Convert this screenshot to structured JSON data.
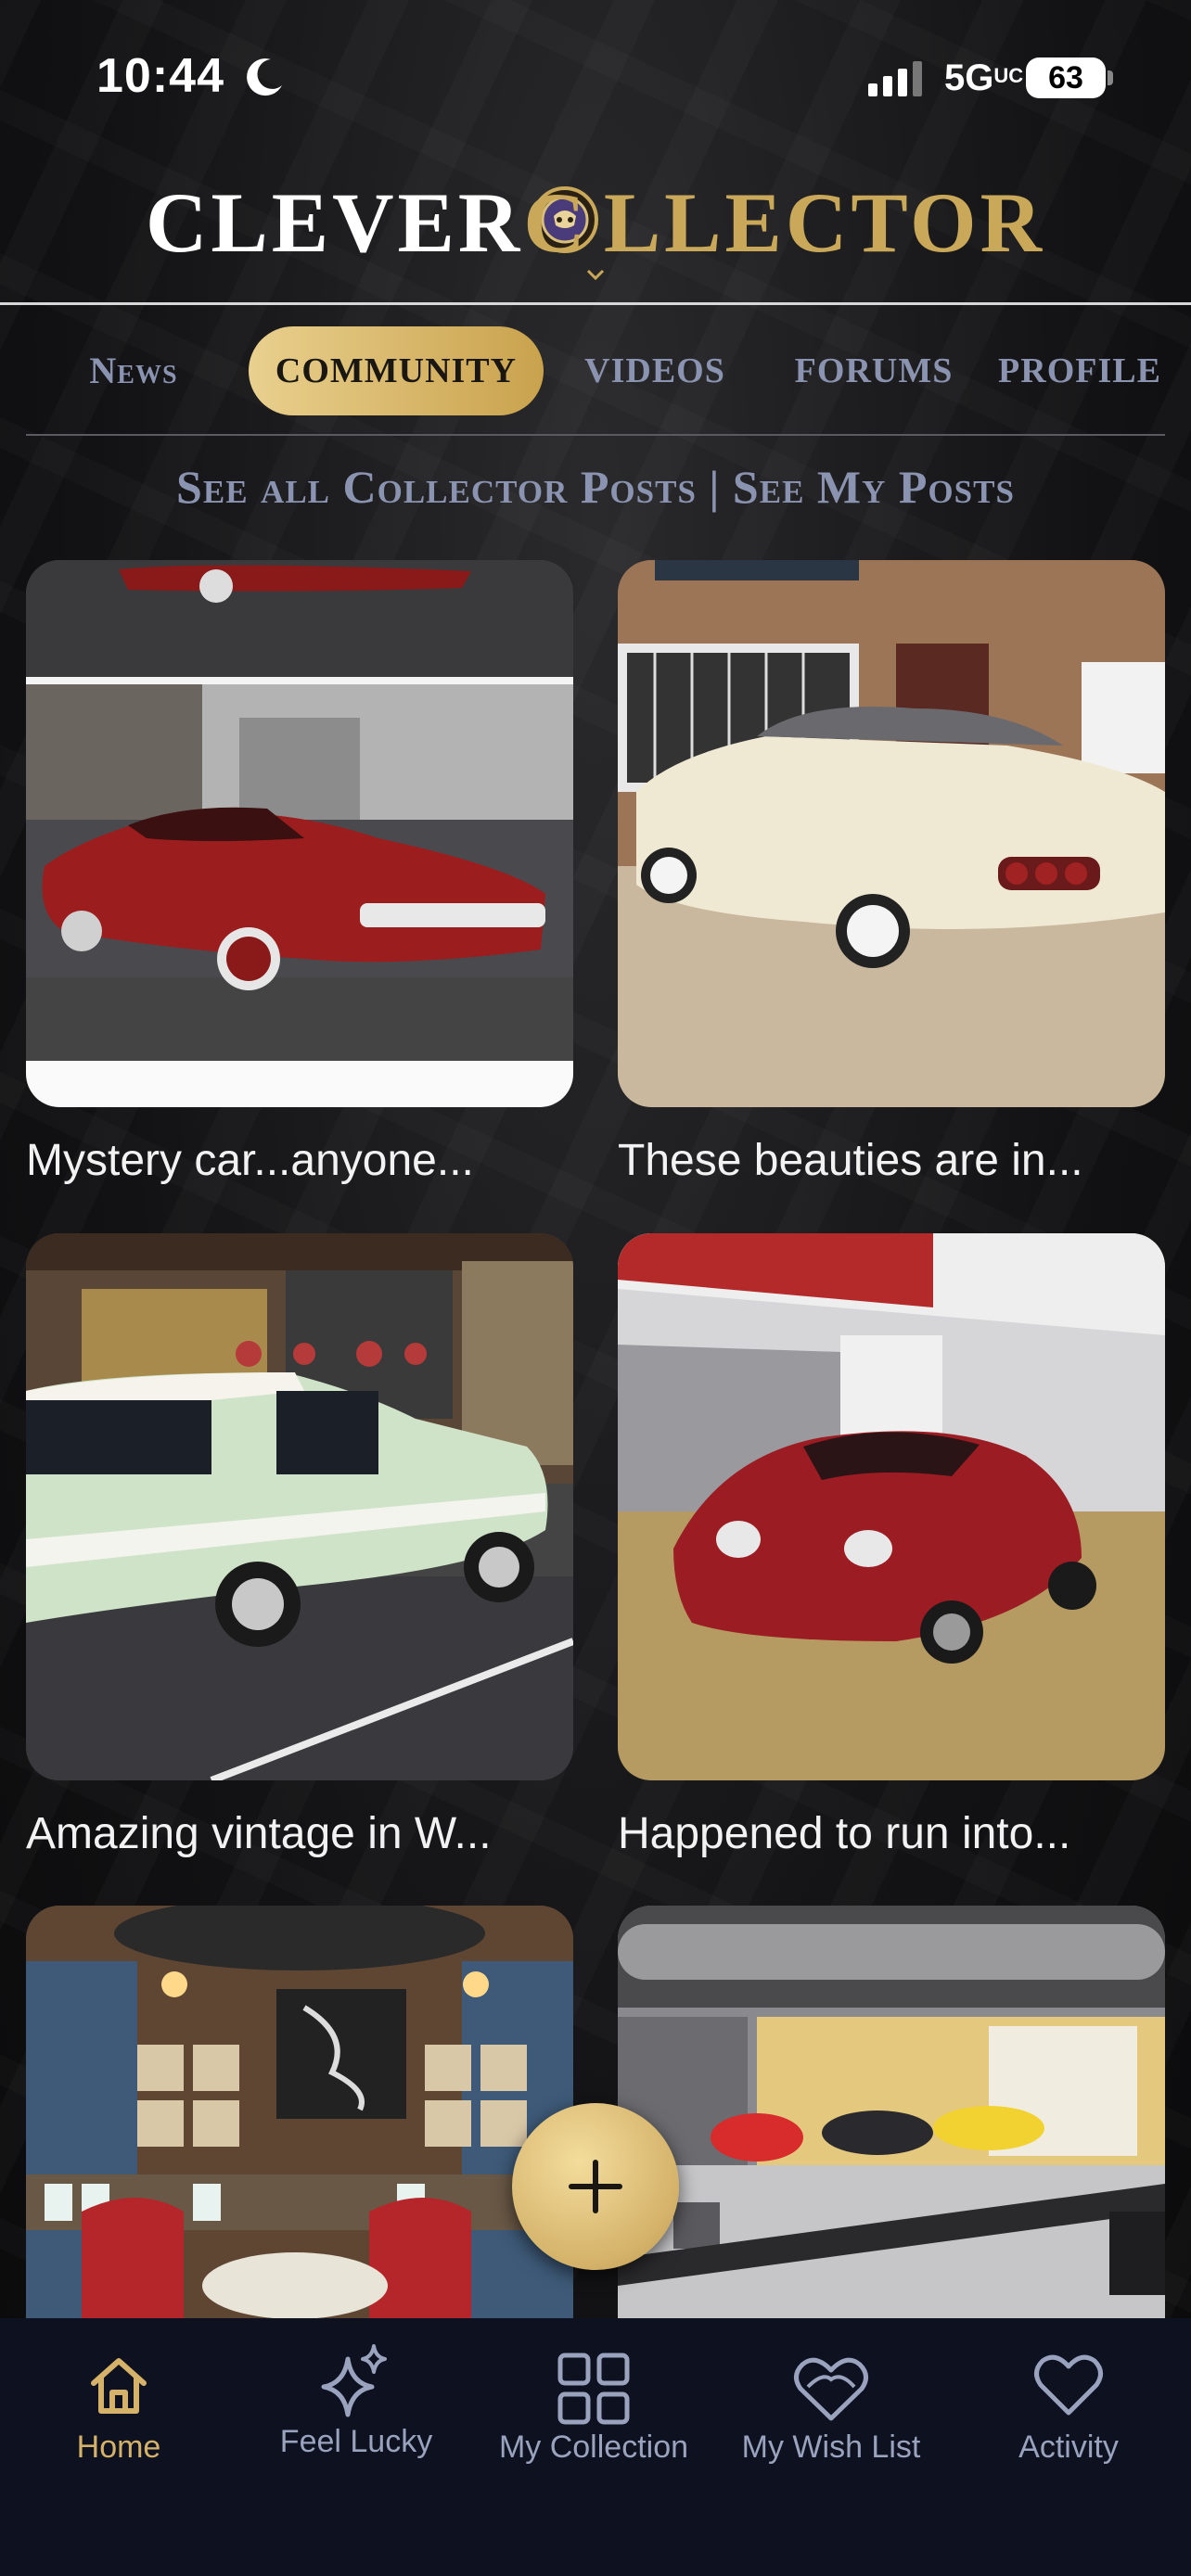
{
  "status_bar": {
    "time": "10:44",
    "network": "5G",
    "network_suffix": "UC",
    "battery": "63"
  },
  "brand": {
    "part1": "CLEVER",
    "part2_initial": "C",
    "part2": "LLECTOR"
  },
  "tabs": [
    {
      "label": "News",
      "active": false
    },
    {
      "label": "COMMUNITY",
      "active": true
    },
    {
      "label": "VIDEOS",
      "active": false
    },
    {
      "label": "FORUMS",
      "active": false
    },
    {
      "label": "PROFILE",
      "active": false
    }
  ],
  "posts_links": {
    "all": "See all Collector Posts",
    "separator": "|",
    "mine": "See My Posts"
  },
  "posts": [
    {
      "title": "Mystery car...anyone...",
      "image": "red custom coupe"
    },
    {
      "title": "These beauties are in...",
      "image": "cream convertible thunderbird"
    },
    {
      "title": "Amazing vintage in W...",
      "image": "mint green vintage sedan"
    },
    {
      "title": "Happened to run into...",
      "image": "red porsche in garage"
    },
    {
      "title": "",
      "image": "lounge with red chairs"
    },
    {
      "title": "",
      "image": "garage with sports cars"
    }
  ],
  "fab": {
    "icon": "plus-icon"
  },
  "bottom_nav": [
    {
      "label": "Home",
      "icon": "home-icon",
      "active": true
    },
    {
      "label": "Feel Lucky",
      "icon": "sparkles-icon",
      "active": false
    },
    {
      "label": "My Collection",
      "icon": "grid-icon",
      "active": false
    },
    {
      "label": "My Wish List",
      "icon": "heart-outline-icon",
      "active": false
    },
    {
      "label": "Activity",
      "icon": "heart-icon",
      "active": false
    }
  ],
  "colors": {
    "gold": "#c9a959",
    "tab_text": "#8a93b0",
    "nav_bg": "#0d1120"
  }
}
